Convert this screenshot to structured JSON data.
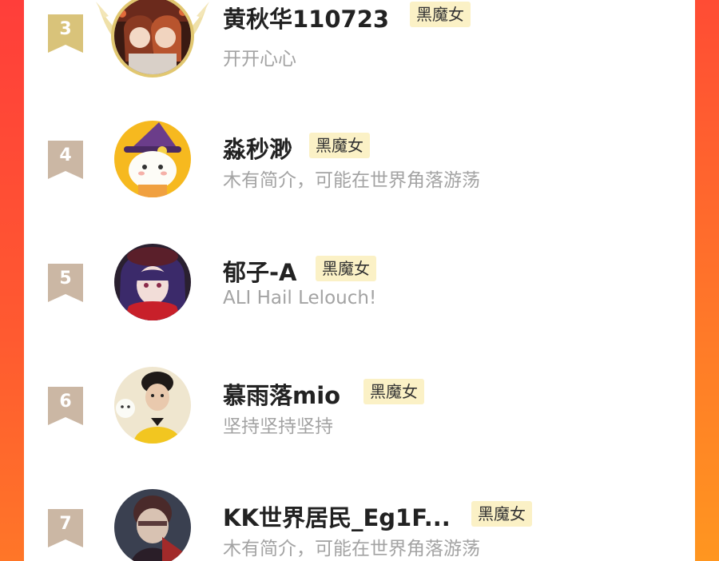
{
  "ranking": [
    {
      "rank": "3",
      "name": "黄秋华110723",
      "badge": "黑魔女",
      "bio": "开开心心"
    },
    {
      "rank": "4",
      "name": "淼秒渺",
      "badge": "黑魔女",
      "bio": "木有简介，可能在世界角落游荡"
    },
    {
      "rank": "5",
      "name": "郁子-A",
      "badge": "黑魔女",
      "bio": "ALI Hail Lelouch!"
    },
    {
      "rank": "6",
      "name": "慕雨落mio",
      "badge": "黑魔女",
      "bio": "坚持坚持坚持"
    },
    {
      "rank": "7",
      "name": "KK世界居民_Eg1F...",
      "badge": "黑魔女",
      "bio": "木有简介，可能在世界角落游荡"
    }
  ],
  "colors": {
    "background_gradient": [
      "#ff4a3a",
      "#ff8a24"
    ],
    "card": "#ffffff",
    "rank3_flag": "#d9c37a",
    "rank_flag": "#cbb7a4",
    "badge_bg": "#fbf1c6",
    "name": "#222222",
    "bio": "#a3a3a3"
  }
}
